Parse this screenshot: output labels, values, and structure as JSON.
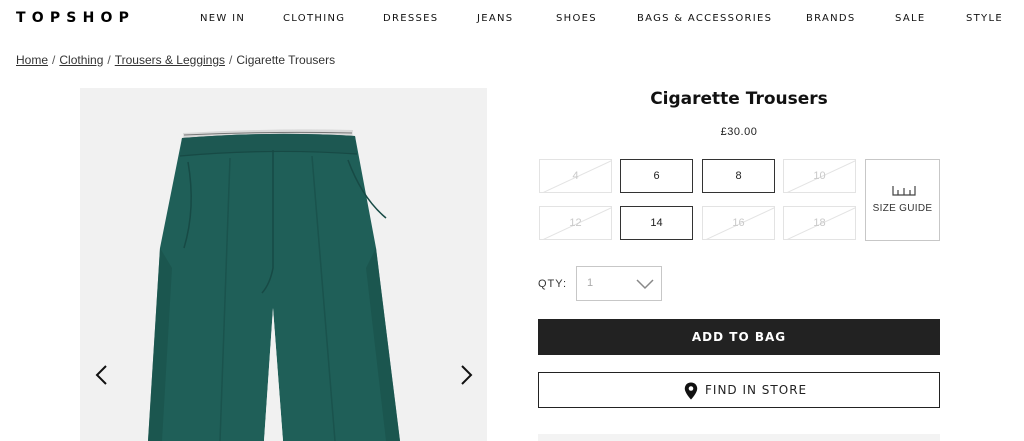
{
  "header": {
    "logo": "TOPSHOP",
    "nav": [
      {
        "id": "new-in",
        "label": "NEW IN"
      },
      {
        "id": "clothing",
        "label": "CLOTHING"
      },
      {
        "id": "dresses",
        "label": "DRESSES"
      },
      {
        "id": "jeans",
        "label": "JEANS"
      },
      {
        "id": "shoes",
        "label": "SHOES"
      },
      {
        "id": "bags",
        "label": "BAGS & ACCESSORIES"
      },
      {
        "id": "brands",
        "label": "BRANDS"
      },
      {
        "id": "sale",
        "label": "SALE"
      },
      {
        "id": "style",
        "label": "STYLE"
      }
    ]
  },
  "breadcrumb": {
    "items": [
      "Home",
      "Clothing",
      "Trousers & Leggings"
    ],
    "current": "Cigarette Trousers",
    "separator": "/"
  },
  "gallery": {
    "prev_icon": "chevron-left-icon",
    "next_icon": "chevron-right-icon",
    "product_color": "#1f5f58"
  },
  "product": {
    "title": "Cigarette Trousers",
    "price": "£30.00",
    "sizes": [
      {
        "label": "4",
        "available": false
      },
      {
        "label": "6",
        "available": true
      },
      {
        "label": "8",
        "available": true
      },
      {
        "label": "10",
        "available": false
      },
      {
        "label": "12",
        "available": false
      },
      {
        "label": "14",
        "available": true
      },
      {
        "label": "16",
        "available": false
      },
      {
        "label": "18",
        "available": false
      }
    ],
    "size_guide": {
      "label": "SIZE GUIDE",
      "icon": "ruler-icon"
    },
    "qty": {
      "label": "QTY:",
      "value": "1"
    },
    "add_to_bag": "ADD TO BAG",
    "find_in_store": {
      "label": "FIND IN STORE",
      "icon": "location-pin-icon"
    }
  },
  "colors": {
    "button_dark": "#222222",
    "unavailable": "#c9c9c9"
  }
}
